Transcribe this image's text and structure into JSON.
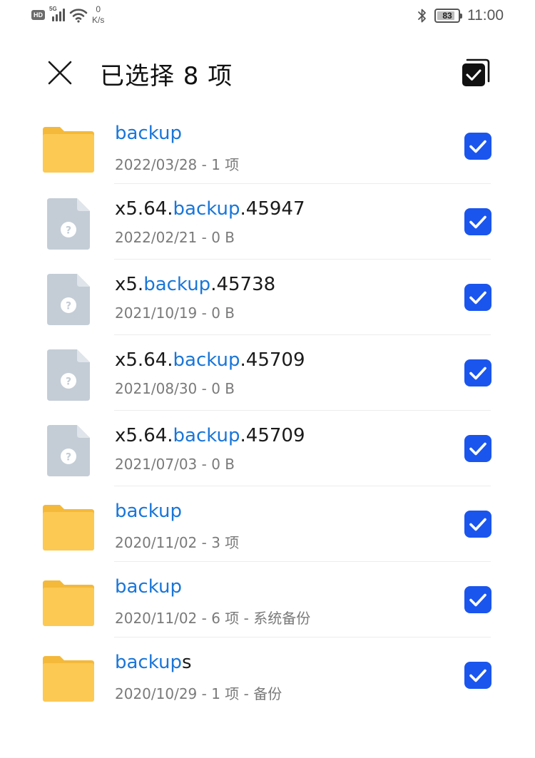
{
  "status_bar": {
    "hd_label": "HD",
    "network_label": "5G",
    "speed_value": "0",
    "speed_unit": "K/s",
    "battery": "83",
    "time": "11:00",
    "icons": [
      "hd-icon",
      "signal-icon",
      "wifi-icon",
      "bluetooth-icon",
      "battery-icon"
    ]
  },
  "header": {
    "title": "已选择 8 项",
    "close_icon": "close-icon",
    "select_all_icon": "select-all-icon"
  },
  "colors": {
    "highlight": "#1976d8",
    "checkbox": "#1a55ee",
    "folder": "#fcc953",
    "unknown_file": "#c4cdd6"
  },
  "files": [
    {
      "type": "folder",
      "name_parts": [
        {
          "text": "backup",
          "hl": true
        }
      ],
      "meta": "2022/03/28 - 1 项",
      "checked": true
    },
    {
      "type": "unknown",
      "name_parts": [
        {
          "text": "x5.64.",
          "hl": false
        },
        {
          "text": "backup",
          "hl": true
        },
        {
          "text": ".45947",
          "hl": false
        }
      ],
      "meta": "2022/02/21 - 0 B",
      "checked": true
    },
    {
      "type": "unknown",
      "name_parts": [
        {
          "text": "x5.",
          "hl": false
        },
        {
          "text": "backup",
          "hl": true
        },
        {
          "text": ".45738",
          "hl": false
        }
      ],
      "meta": "2021/10/19 - 0 B",
      "checked": true
    },
    {
      "type": "unknown",
      "name_parts": [
        {
          "text": "x5.64.",
          "hl": false
        },
        {
          "text": "backup",
          "hl": true
        },
        {
          "text": ".45709",
          "hl": false
        }
      ],
      "meta": "2021/08/30 - 0 B",
      "checked": true
    },
    {
      "type": "unknown",
      "name_parts": [
        {
          "text": "x5.64.",
          "hl": false
        },
        {
          "text": "backup",
          "hl": true
        },
        {
          "text": ".45709",
          "hl": false
        }
      ],
      "meta": "2021/07/03 - 0 B",
      "checked": true
    },
    {
      "type": "folder",
      "name_parts": [
        {
          "text": "backup",
          "hl": true
        }
      ],
      "meta": "2020/11/02 - 3 项",
      "checked": true
    },
    {
      "type": "folder",
      "name_parts": [
        {
          "text": "backup",
          "hl": true
        }
      ],
      "meta": "2020/11/02 - 6 项 - 系统备份",
      "checked": true
    },
    {
      "type": "folder",
      "name_parts": [
        {
          "text": "backup",
          "hl": true
        },
        {
          "text": "s",
          "hl": false
        }
      ],
      "meta": "2020/10/29 - 1 项 - 备份",
      "checked": true
    }
  ]
}
